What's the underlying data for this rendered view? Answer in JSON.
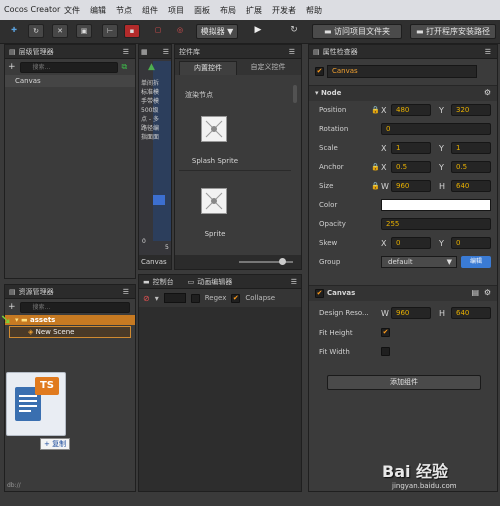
{
  "app": {
    "title": "Cocos Creator"
  },
  "menu": [
    "文件",
    "编辑",
    "节点",
    "组件",
    "项目",
    "面板",
    "布局",
    "扩展",
    "开发者",
    "帮助"
  ],
  "toolbar": {
    "simulator_label": "模拟器 ▼",
    "open_project_btn": "访问项目文件夹",
    "open_install_btn": "打开程序安装路径"
  },
  "hierarchy": {
    "title": "层级管理器",
    "search_placeholder": "搜索...",
    "root_item": "Canvas"
  },
  "assets": {
    "title": "资源管理器",
    "search_placeholder": "搜索...",
    "folder": "assets",
    "scene": "New Scene",
    "status_path": "db://"
  },
  "scene": {
    "labels": [
      "单间拆",
      "标准模",
      "手带模",
      "500级",
      "点 - 多",
      "路径编",
      "指面面"
    ],
    "footer": "Canvas",
    "ruler_0": "0",
    "ruler_5": "5"
  },
  "widget_lib": {
    "title": "控件库",
    "tab_builtin": "内置控件",
    "tab_custom": "自定义控件",
    "section": "渲染节点",
    "items": [
      {
        "label": "Splash Sprite"
      },
      {
        "label": "Sprite"
      }
    ]
  },
  "console": {
    "title": "控制台",
    "animation_tab": "动画编辑器",
    "regex_label": "Regex",
    "collapse_label": "Collapse"
  },
  "inspector": {
    "title": "属性检查器",
    "node_name": "Canvas",
    "node_section": "Node",
    "position": {
      "label": "Position",
      "x": "480",
      "y": "320"
    },
    "rotation": {
      "label": "Rotation",
      "value": "0"
    },
    "scale": {
      "label": "Scale",
      "x": "1",
      "y": "1"
    },
    "anchor": {
      "label": "Anchor",
      "x": "0.5",
      "y": "0.5"
    },
    "size": {
      "label": "Size",
      "w": "960",
      "h": "640"
    },
    "color": {
      "label": "Color"
    },
    "opacity": {
      "label": "Opacity",
      "value": "255"
    },
    "skew": {
      "label": "Skew",
      "x": "0",
      "y": "0"
    },
    "group": {
      "label": "Group",
      "value": "default",
      "edit_btn": "编辑"
    },
    "canvas_section": "Canvas",
    "design_res": {
      "label": "Design Reso...",
      "w": "960",
      "h": "640"
    },
    "fit_height": "Fit Height",
    "fit_width": "Fit Width",
    "add_component": "添加组件"
  },
  "axis": {
    "x": "X",
    "y": "Y",
    "w": "W",
    "h": "H"
  },
  "drag": {
    "badge": "TS",
    "copy_label": "+ 复制"
  },
  "watermark": {
    "text": "Bai 经验",
    "url": "jingyan.baidu.com"
  },
  "colors": {
    "accent": "#f0a030",
    "selection": "#8a5a24"
  }
}
